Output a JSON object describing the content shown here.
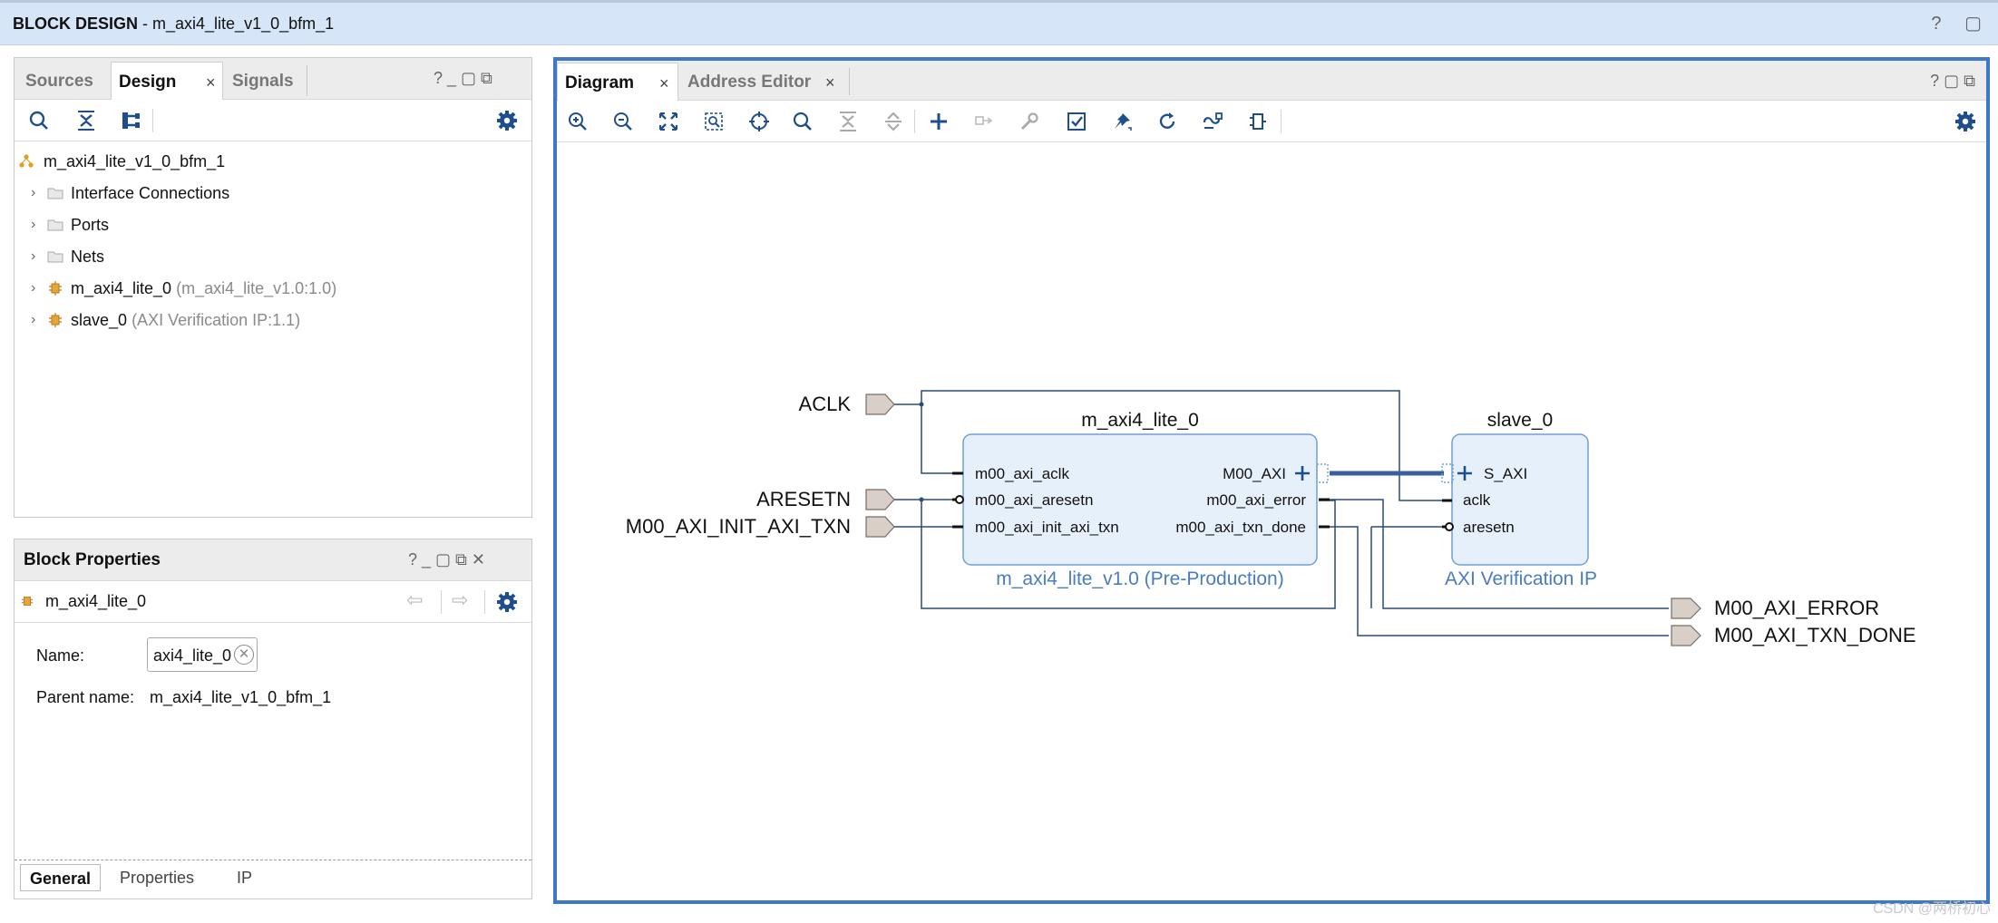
{
  "window": {
    "title_bold": "BLOCK DESIGN",
    "title_rest": " - m_axi4_lite_v1_0_bfm_1",
    "controls": "? ▢"
  },
  "sources_panel": {
    "tabs": [
      "Sources",
      "Design",
      "Signals"
    ],
    "active_tab": "Design",
    "tab_close": "×",
    "header_icons": "?  _  ▢  ⧉",
    "root": "m_axi4_lite_v1_0_bfm_1",
    "items": [
      {
        "label": "Interface Connections",
        "detail": "",
        "icon": "folder-icon"
      },
      {
        "label": "Ports",
        "detail": "",
        "icon": "folder-icon"
      },
      {
        "label": "Nets",
        "detail": "",
        "icon": "folder-icon"
      },
      {
        "label": "m_axi4_lite_0",
        "detail": "(m_axi4_lite_v1.0:1.0)",
        "icon": "ip-block-icon"
      },
      {
        "label": "slave_0",
        "detail": "(AXI Verification IP:1.1)",
        "icon": "ip-block-icon"
      }
    ]
  },
  "block_properties": {
    "title": "Block Properties",
    "header_icons": "?  _  ▢  ⧉  ✕",
    "selected": "m_axi4_lite_0",
    "name_label": "Name:",
    "name_value": "axi4_lite_0",
    "parent_label": "Parent name:",
    "parent_value": "m_axi4_lite_v1_0_bfm_1",
    "tabs": [
      "General",
      "Properties",
      "IP"
    ],
    "active_tab": "General"
  },
  "diagram_panel": {
    "tabs": [
      "Diagram",
      "Address Editor"
    ],
    "active_tab": "Diagram",
    "tab_close": "×",
    "header_icons": "?  ▢  ⧉",
    "toolbar_icons": [
      "zoom-in-icon",
      "zoom-out-icon",
      "zoom-fit-icon",
      "zoom-area-icon",
      "center-icon",
      "search-icon",
      "collapse-icon",
      "expand-icon",
      "add-ip-icon",
      "disconnect-icon",
      "wrench-icon",
      "validate-icon",
      "pin-icon",
      "refresh-icon",
      "auto-connect-icon",
      "regenerate-layout-icon"
    ]
  },
  "diagram": {
    "ports_in": [
      "ACLK",
      "ARESETN",
      "M00_AXI_INIT_AXI_TXN"
    ],
    "ports_out": [
      "M00_AXI_ERROR",
      "M00_AXI_TXN_DONE"
    ],
    "master_block": {
      "name": "m_axi4_lite_0",
      "subtitle": "m_axi4_lite_v1.0 (Pre-Production)",
      "left_pins": [
        "m00_axi_aclk",
        "m00_axi_aresetn",
        "m00_axi_init_axi_txn"
      ],
      "right_pins": [
        "M00_AXI",
        "m00_axi_error",
        "m00_axi_txn_done"
      ]
    },
    "slave_block": {
      "name": "slave_0",
      "subtitle": "AXI Verification IP",
      "pins": [
        "S_AXI",
        "aclk",
        "aresetn"
      ]
    }
  },
  "watermark": "CSDN @两桥初心",
  "colors": {
    "accent": "#3e78c8",
    "block_fill": "#e6f0fb",
    "block_border": "#6f9fd8",
    "subtitle": "#4a7cc0",
    "port_fill": "#d8cfc8"
  }
}
